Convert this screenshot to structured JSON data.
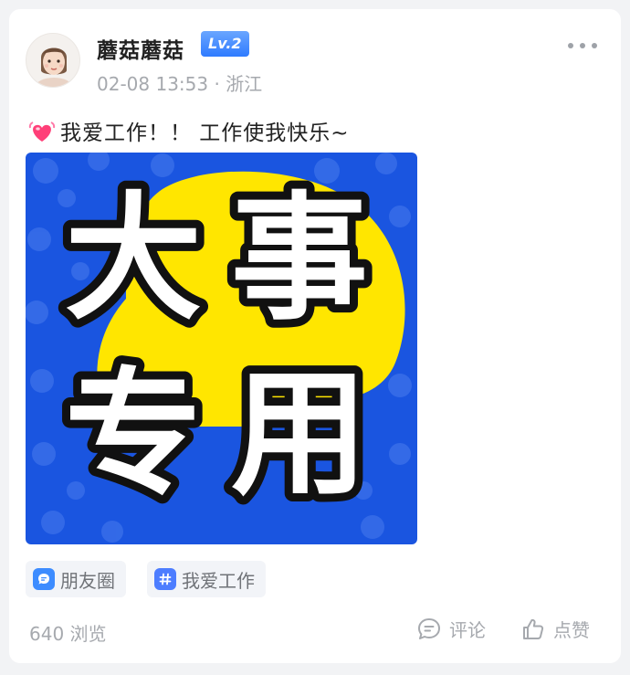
{
  "post": {
    "author": "蘑菇蘑菇",
    "level": "Lv.2",
    "datetime": "02-08 13:53",
    "location_sep": " · ",
    "location": "浙江",
    "text": "我爱工作！！ 工作使我快乐~",
    "image": {
      "char1": "大",
      "char2": "事",
      "char3": "专",
      "char4": "用",
      "colors": {
        "background": "#1a55e0",
        "blob": "#ffe600",
        "text": "#ffffff",
        "outline": "#111111"
      }
    },
    "tags": [
      {
        "label": "朋友圈",
        "icon": "chat-bubble-icon"
      },
      {
        "label": "我爱工作",
        "icon": "hashtag-icon"
      }
    ],
    "views": "640 浏览",
    "actions": {
      "comment": "评论",
      "like": "点赞"
    }
  },
  "colors": {
    "accent": "#2f7bff",
    "muted": "#a6a9ae"
  }
}
